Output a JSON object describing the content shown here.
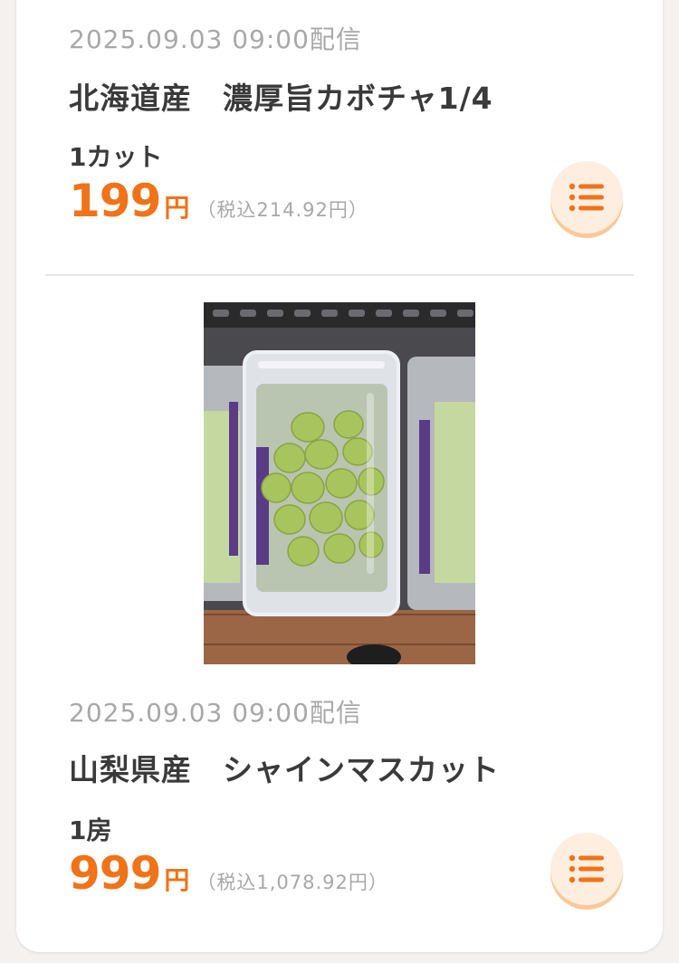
{
  "products": [
    {
      "date": "2025.09.03 09:00配信",
      "title": "北海道産　濃厚旨カボチャ1/4",
      "unit": "1カット",
      "price": "199",
      "yen": "円",
      "tax": "（税込214.92円）"
    },
    {
      "date": "2025.09.03 09:00配信",
      "title": "山梨県産　シャインマスカット",
      "unit": "1房",
      "price": "999",
      "yen": "円",
      "tax": "（税込1,078.92円）"
    }
  ],
  "colors": {
    "accent": "#f07319",
    "muted": "#a8a8a8",
    "button_bg": "#fdeee0"
  },
  "icons": {
    "list_button": "list-icon"
  }
}
